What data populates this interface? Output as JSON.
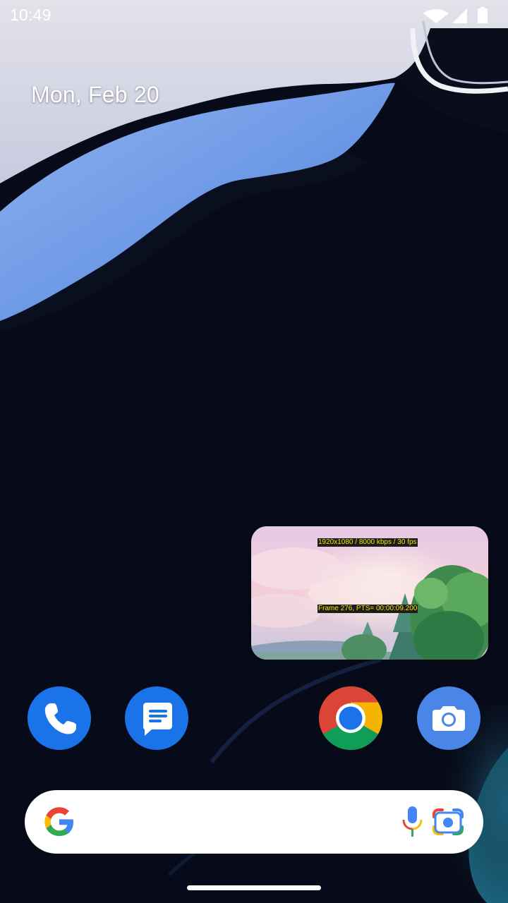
{
  "status_bar": {
    "time": "10:49",
    "icons": [
      "wifi-icon",
      "cellular-signal-icon",
      "battery-icon"
    ]
  },
  "date_widget": {
    "text": "Mon, Feb 20"
  },
  "pip_video": {
    "overlay_resolution": "1920x1080 / 8000 kbps / 30 fps",
    "overlay_frame": "Frame 276, PTS= 00:00:09.200"
  },
  "dock": {
    "apps": [
      {
        "name": "Phone",
        "icon": "phone-icon"
      },
      {
        "name": "Messages",
        "icon": "messages-icon"
      },
      {
        "name": "Chrome",
        "icon": "chrome-icon"
      },
      {
        "name": "Camera",
        "icon": "camera-icon"
      }
    ]
  },
  "search_bar": {
    "icons": [
      "google-logo-icon",
      "microphone-icon",
      "lens-icon"
    ]
  },
  "colors": {
    "wallpaper_dark": "#070a18",
    "wallpaper_blue": "#6f9ae6",
    "wallpaper_light": "#e8e8f0",
    "app_blue": "#1a73e8",
    "overlay_text": "#f5e400"
  }
}
